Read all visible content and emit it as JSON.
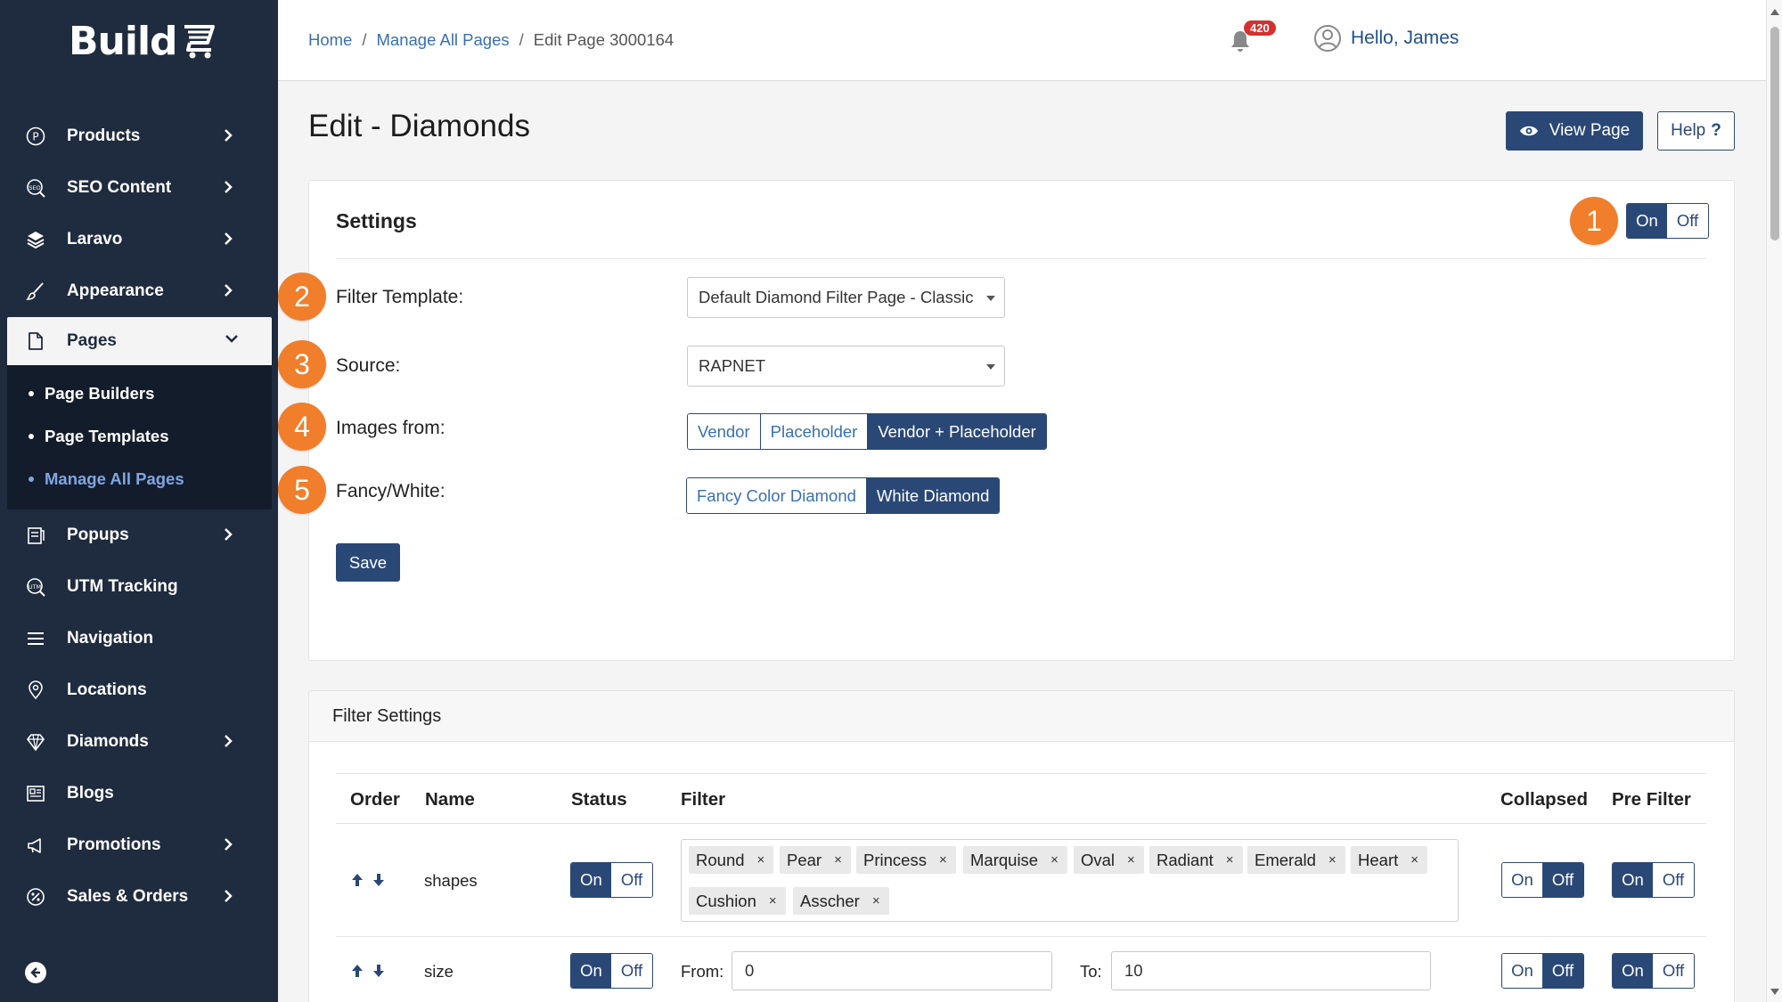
{
  "app": {
    "logo_text": "Build"
  },
  "sidebar": {
    "items": [
      {
        "label": "Products",
        "icon": "products-circle-p-icon",
        "has_chevron": true
      },
      {
        "label": "SEO Content",
        "icon": "seo-icon",
        "has_chevron": true
      },
      {
        "label": "Laravo",
        "icon": "layers-icon",
        "has_chevron": true
      },
      {
        "label": "Appearance",
        "icon": "brush-icon",
        "has_chevron": true
      },
      {
        "label": "Pages",
        "icon": "page-icon",
        "has_chevron": true,
        "expanded": true
      },
      {
        "label": "Popups",
        "icon": "popup-icon",
        "has_chevron": true
      },
      {
        "label": "UTM Tracking",
        "icon": "utm-icon",
        "has_chevron": false
      },
      {
        "label": "Navigation",
        "icon": "menu-icon",
        "has_chevron": false
      },
      {
        "label": "Locations",
        "icon": "location-pin-icon",
        "has_chevron": false
      },
      {
        "label": "Diamonds",
        "icon": "diamond-icon",
        "has_chevron": true
      },
      {
        "label": "Blogs",
        "icon": "blog-icon",
        "has_chevron": false
      },
      {
        "label": "Promotions",
        "icon": "megaphone-icon",
        "has_chevron": true
      },
      {
        "label": "Sales & Orders",
        "icon": "sales-icon",
        "has_chevron": true
      }
    ],
    "pages_sub": [
      "Page Builders",
      "Page Templates",
      "Manage All Pages"
    ],
    "current_sub": "Manage All Pages"
  },
  "breadcrumb": {
    "home": "Home",
    "manage": "Manage All Pages",
    "current": "Edit Page 3000164",
    "sep": "/"
  },
  "header": {
    "notification_count": "420",
    "greeting": "Hello, James"
  },
  "page": {
    "title": "Edit - Diamonds",
    "view_button": "View Page",
    "help_button": "Help",
    "help_mark": "?"
  },
  "settings": {
    "title": "Settings",
    "toggle": {
      "on": "On",
      "off": "Off",
      "selected": "On"
    },
    "markers": [
      "1",
      "2",
      "3",
      "4",
      "5"
    ],
    "filter_template_label": "Filter Template:",
    "filter_template_value": "Default Diamond Filter Page - Classic",
    "source_label": "Source:",
    "source_value": "RAPNET",
    "images_label": "Images from:",
    "images_options": [
      "Vendor",
      "Placeholder",
      "Vendor + Placeholder"
    ],
    "images_selected": "Vendor + Placeholder",
    "fancy_label": "Fancy/White:",
    "fancy_options": [
      "Fancy Color Diamond",
      "White Diamond"
    ],
    "fancy_selected": "White Diamond",
    "save_button": "Save"
  },
  "filter_settings": {
    "title": "Filter Settings",
    "columns": [
      "Order",
      "Name",
      "Status",
      "Filter",
      "Collapsed",
      "Pre Filter"
    ],
    "rows": [
      {
        "name": "shapes",
        "status": "On",
        "tags": [
          "Round",
          "Pear",
          "Princess",
          "Marquise",
          "Oval",
          "Radiant",
          "Emerald",
          "Heart",
          "Cushion",
          "Asscher"
        ],
        "collapsed": "Off",
        "pre_filter": "On"
      },
      {
        "name": "size",
        "status": "On",
        "from_label": "From:",
        "from_value": "0",
        "to_label": "To:",
        "to_value": "10",
        "collapsed": "Off",
        "pre_filter": "On"
      }
    ],
    "on_label": "On",
    "off_label": "Off",
    "tag_remove": "×"
  },
  "colors": {
    "sidebar_bg": "#1f2b3e",
    "primary": "#2a4876",
    "link": "#3a6fb0",
    "marker": "#f07e2a",
    "badge": "#d62f2f"
  }
}
